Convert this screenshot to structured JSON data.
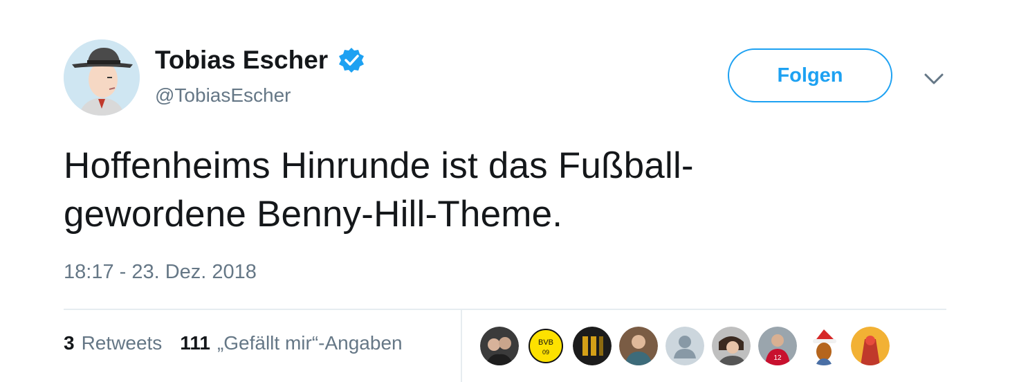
{
  "author": {
    "name": "Tobias Escher",
    "handle": "@TobiasEscher",
    "verified": true
  },
  "actions": {
    "follow_label": "Folgen"
  },
  "tweet": {
    "lines": [
      "Hoffenheims Hinrunde ist das Fußball-",
      "gewordene Benny-Hill-Theme."
    ],
    "timestamp": "18:17 - 23. Dez. 2018"
  },
  "stats": {
    "retweets_count": "3",
    "retweets_label": "Retweets",
    "likes_count": "111",
    "likes_label": "„Gefällt mir“-Angaben"
  },
  "colors": {
    "accent": "#1da1f2",
    "secondary_text": "#657786",
    "divider": "#e6ecf0"
  },
  "likers": [
    {
      "icon": "user-avatar-photo"
    },
    {
      "icon": "bvb-logo-avatar"
    },
    {
      "icon": "user-avatar-dark"
    },
    {
      "icon": "user-avatar-photo"
    },
    {
      "icon": "default-user-icon"
    },
    {
      "icon": "user-avatar-photo"
    },
    {
      "icon": "user-avatar-red-jersey"
    },
    {
      "icon": "santa-hat-cartoon-avatar"
    },
    {
      "icon": "user-avatar-red"
    }
  ]
}
